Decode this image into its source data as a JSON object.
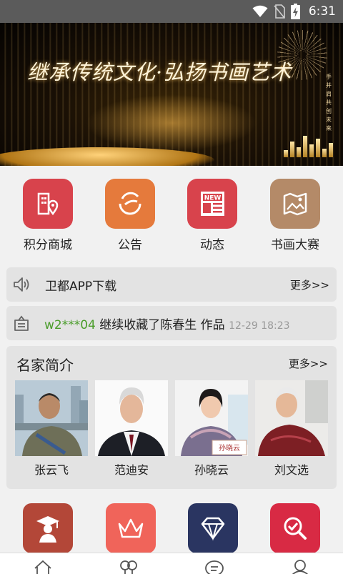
{
  "status_bar": {
    "time": "6:31",
    "icons": [
      "wifi-icon",
      "no-sim-icon",
      "battery-charging-icon"
    ]
  },
  "banner": {
    "slogan": "继承传统文化·弘扬书画艺术",
    "side_text": "手并肩共创未来"
  },
  "quick_menu": [
    {
      "label": "积分商城",
      "icon": "points-mall-icon",
      "color": "#d8434c"
    },
    {
      "label": "公告",
      "icon": "announcement-icon",
      "color": "#e57a3c"
    },
    {
      "label": "动态",
      "icon": "news-icon",
      "color": "#d8434c"
    },
    {
      "label": "书画大赛",
      "icon": "painting-contest-icon",
      "color": "#b48a68"
    }
  ],
  "download_notice": {
    "text": "卫都APP下载",
    "more": "更多>>"
  },
  "activity": {
    "user": "w2***04",
    "action": "继续收藏了陈春生 作品",
    "time": "12-29 18:23"
  },
  "famous": {
    "title": "名家简介",
    "more": "更多>>",
    "artists": [
      {
        "name": "张云飞"
      },
      {
        "name": "范迪安"
      },
      {
        "name": "孙晓云",
        "sign": "孙晓云"
      },
      {
        "name": "刘文选"
      }
    ]
  },
  "bottom_menu": [
    {
      "icon": "scholar-icon",
      "color": "#b34738"
    },
    {
      "icon": "crown-icon",
      "color": "#f0645a"
    },
    {
      "icon": "diamond-icon",
      "color": "#2a3561"
    },
    {
      "icon": "search-check-icon",
      "color": "#d82a44"
    }
  ],
  "tab_bar": {
    "tabs": [
      "home-icon",
      "categories-icon",
      "messages-icon",
      "profile-icon"
    ]
  },
  "colors": {
    "background": "#f1f1f1",
    "card": "#e3e3e3",
    "accent_green": "#4a9d2a"
  }
}
